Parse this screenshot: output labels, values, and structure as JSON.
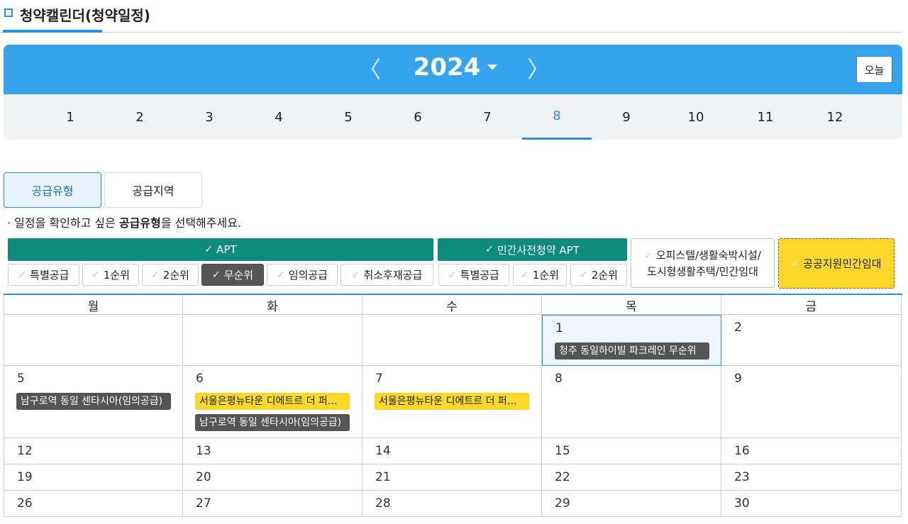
{
  "page_title": "청약캘린더(청약일정)",
  "year_nav": {
    "year": "2024",
    "prev_icon": "chevron-left-icon",
    "next_icon": "chevron-right-icon",
    "prev_glyph": "〈",
    "next_glyph": "〉",
    "today_label": "오늘"
  },
  "months": [
    "1",
    "2",
    "3",
    "4",
    "5",
    "6",
    "7",
    "8",
    "9",
    "10",
    "11",
    "12"
  ],
  "active_month": "8",
  "tabs": [
    {
      "label": "공급유형",
      "active": true
    },
    {
      "label": "공급지역",
      "active": false
    }
  ],
  "guide": {
    "prefix": "· 일정을 확인하고 싶은 ",
    "bold": "공급유형",
    "suffix": "을 선택해주세요."
  },
  "filters": {
    "check_glyph": "✓",
    "apt_header": "APT",
    "apt_chips": [
      {
        "label": "특별공급",
        "checked": false
      },
      {
        "label": "1순위",
        "checked": false
      },
      {
        "label": "2순위",
        "checked": false
      },
      {
        "label": "무순위",
        "checked": true
      },
      {
        "label": "임의공급",
        "checked": false
      },
      {
        "label": "취소후재공급",
        "checked": false
      }
    ],
    "presale_header": "민간사전청약 APT",
    "presale_chips": [
      {
        "label": "특별공급",
        "checked": false
      },
      {
        "label": "1순위",
        "checked": false
      },
      {
        "label": "2순위",
        "checked": false
      }
    ],
    "office_line1": "오피스텔/생활숙박시설/",
    "office_line2": "도시형생활주택/민간임대",
    "public_rental": "공공지원민간임대"
  },
  "calendar": {
    "weekdays": [
      "월",
      "화",
      "수",
      "목",
      "금"
    ],
    "weeks": [
      [
        "",
        "",
        "",
        "1",
        "2"
      ],
      [
        "5",
        "6",
        "7",
        "8",
        "9"
      ],
      [
        "12",
        "13",
        "14",
        "15",
        "16"
      ],
      [
        "19",
        "20",
        "21",
        "22",
        "23"
      ],
      [
        "26",
        "27",
        "28",
        "29",
        "30"
      ]
    ],
    "events": {
      "w0d3": [
        {
          "text": "청주 동일하이빌 파크레인 무순위",
          "style": "dark"
        }
      ],
      "w1d0": [
        {
          "text": "남구로역 동일 센타시아(임의공급)",
          "style": "dark"
        }
      ],
      "w1d1": [
        {
          "text": "서울은평뉴타운 디에트르 더 퍼스트",
          "style": "yellow"
        },
        {
          "text": "남구로역 동일 센타시아(임의공급)",
          "style": "dark"
        }
      ],
      "w1d2": [
        {
          "text": "서울은평뉴타운 디에트르 더 퍼스트",
          "style": "yellow"
        }
      ]
    },
    "today_cell": "w0d3"
  },
  "colors": {
    "accent": "#35a3ed",
    "green": "#0f8a7e",
    "yellow": "#fbd82a",
    "dark_event": "#555555"
  }
}
